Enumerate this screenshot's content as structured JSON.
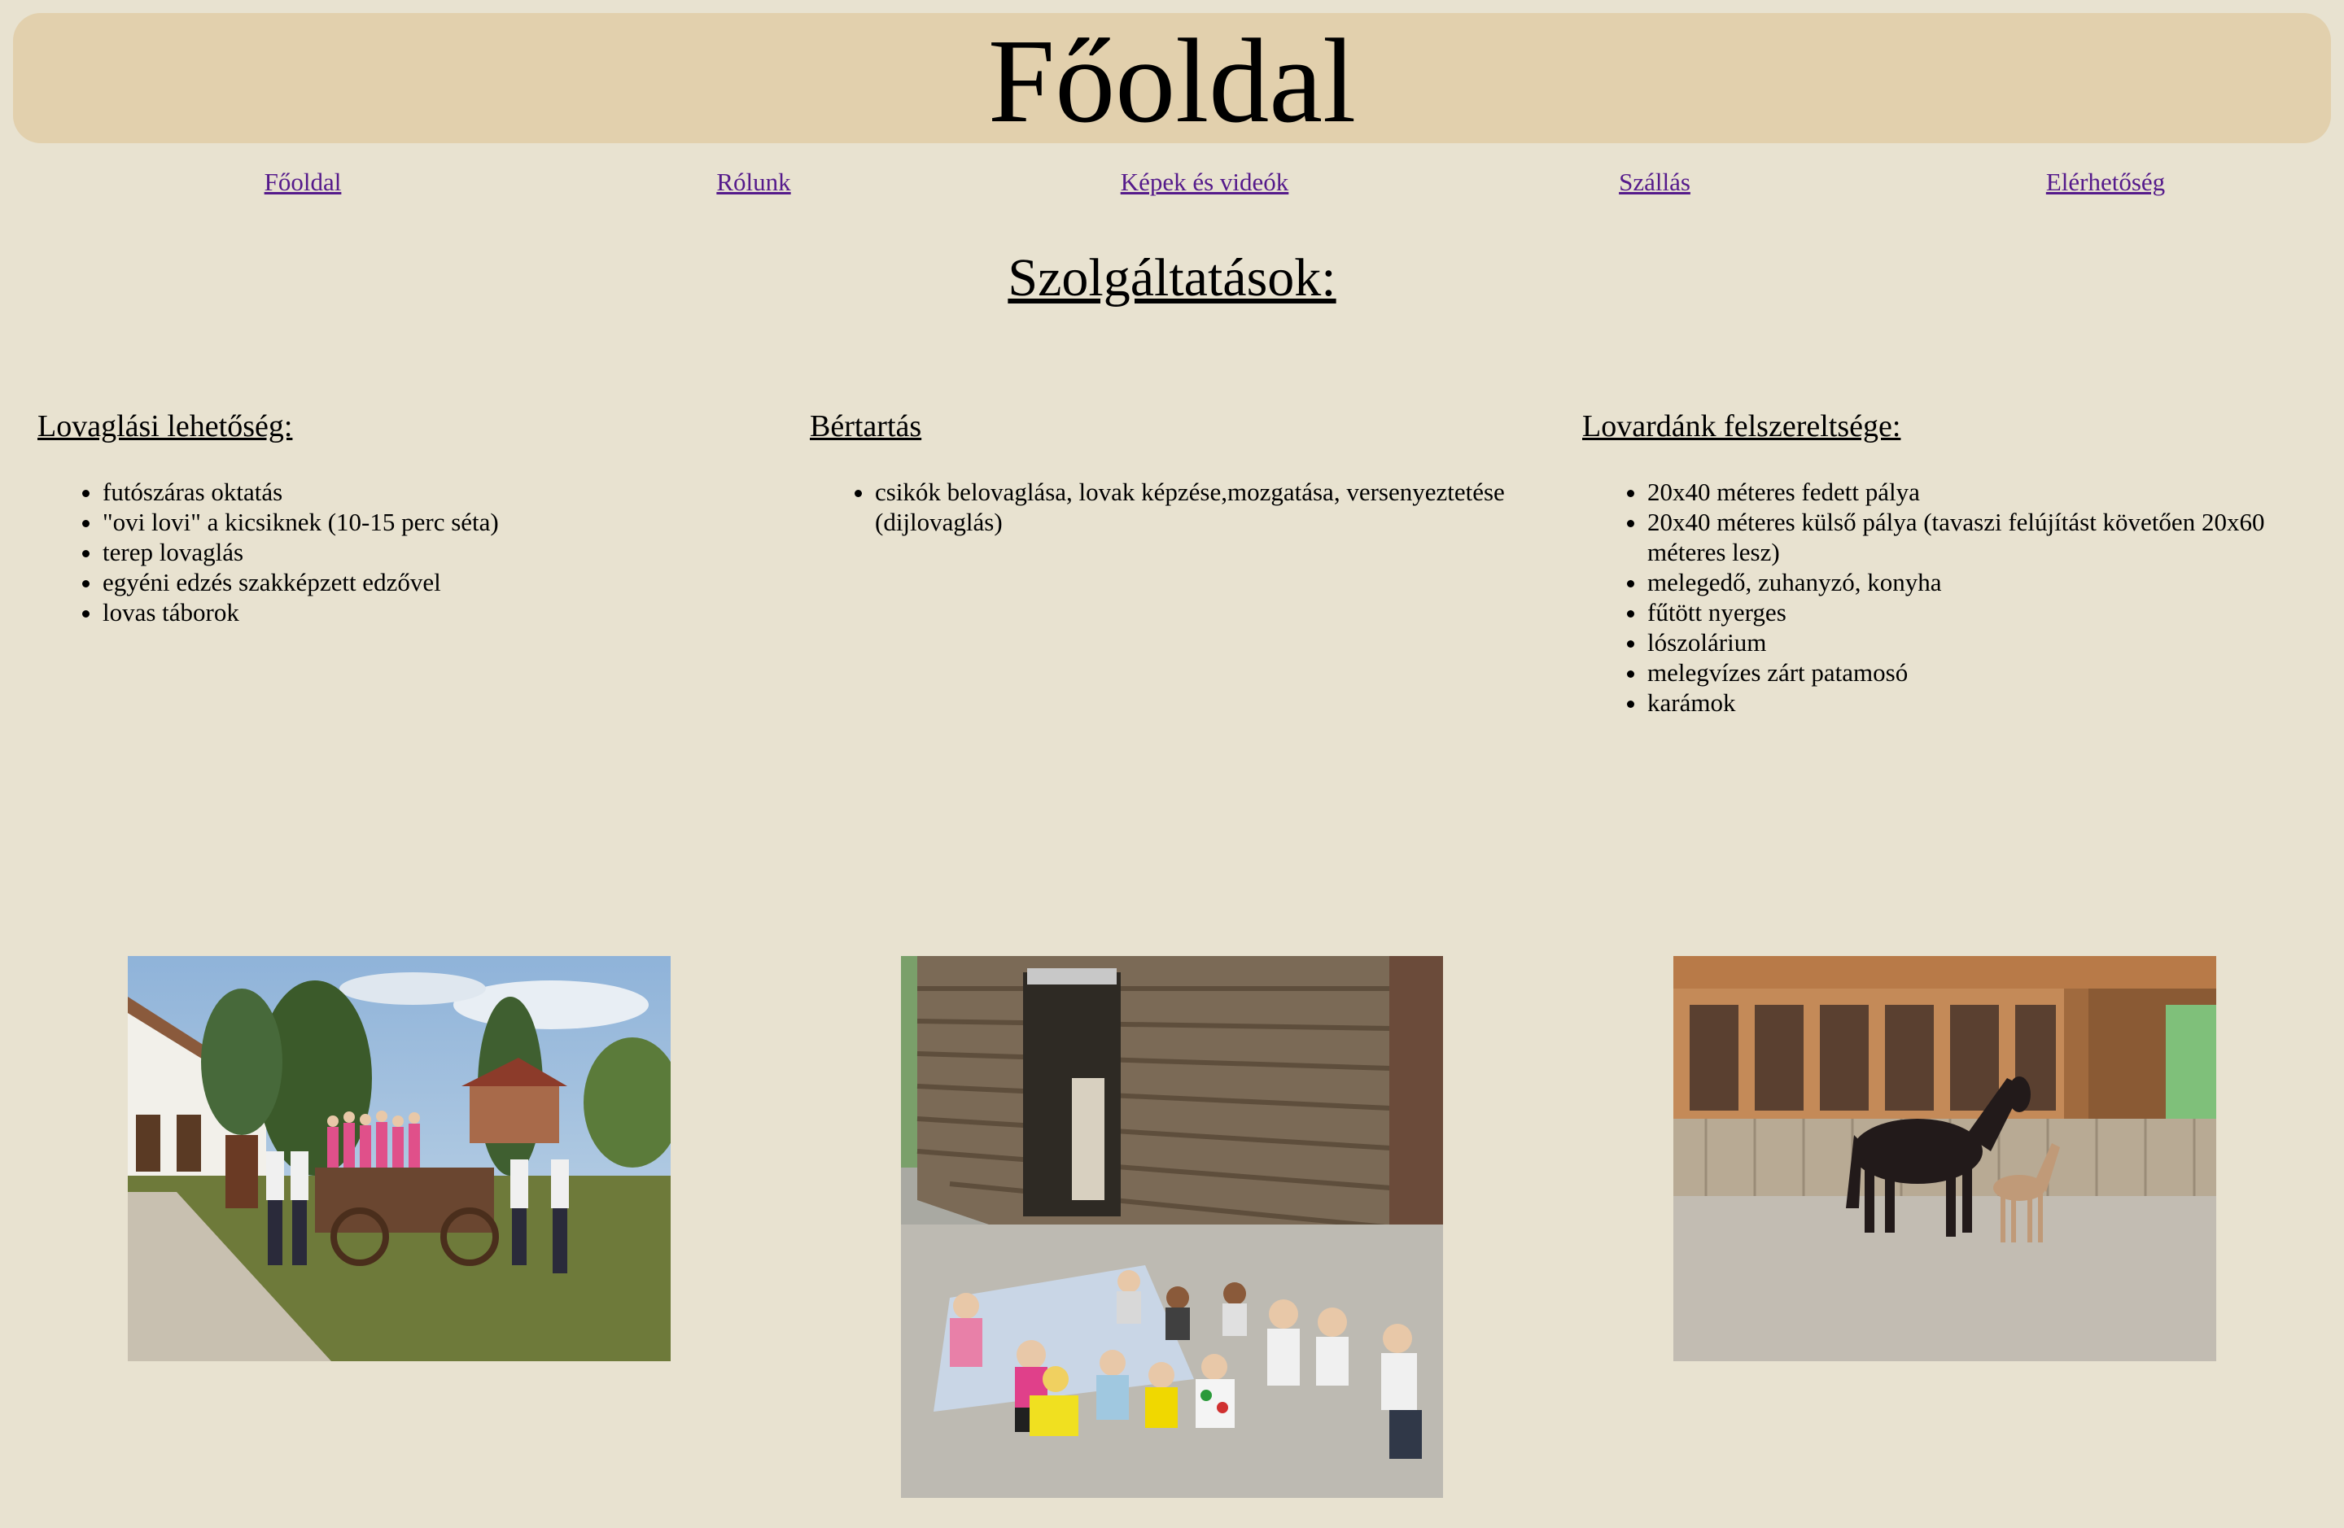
{
  "header": {
    "title": "Főoldal"
  },
  "nav": [
    {
      "label": "Főoldal"
    },
    {
      "label": "Rólunk"
    },
    {
      "label": "Képek és videók"
    },
    {
      "label": "Szállás"
    },
    {
      "label": "Elérhetőség"
    }
  ],
  "services": {
    "title": "Szolgáltatások:"
  },
  "columns": [
    {
      "heading": "Lovaglási lehetőség:",
      "items": [
        "futószáras oktatás",
        "\"ovi lovi\" a kicsiknek (10-15 perc séta)",
        "terep lovaglás",
        "egyéni edzés szakképzett edzővel",
        "lovas táborok"
      ]
    },
    {
      "heading": "Bértartás",
      "items": [
        "csikók belovaglása, lovak képzése,mozgatása, versenyeztetése (dijlovaglás)"
      ]
    },
    {
      "heading": "Lovardánk felszereltsége:",
      "items": [
        "20x40 méteres fedett pálya",
        "20x40 méteres külső pálya (tavaszi felújítást követően 20x60 méteres lesz)",
        "melegedő, zuhanyzó, konyha",
        "fűtött nyerges",
        "lószolárium",
        "melegvízes zárt patamosó",
        "karámok"
      ]
    }
  ],
  "colors": {
    "background": "#e8e2d0",
    "header_bg": "#e2d0ad",
    "link": "#551a8b"
  }
}
